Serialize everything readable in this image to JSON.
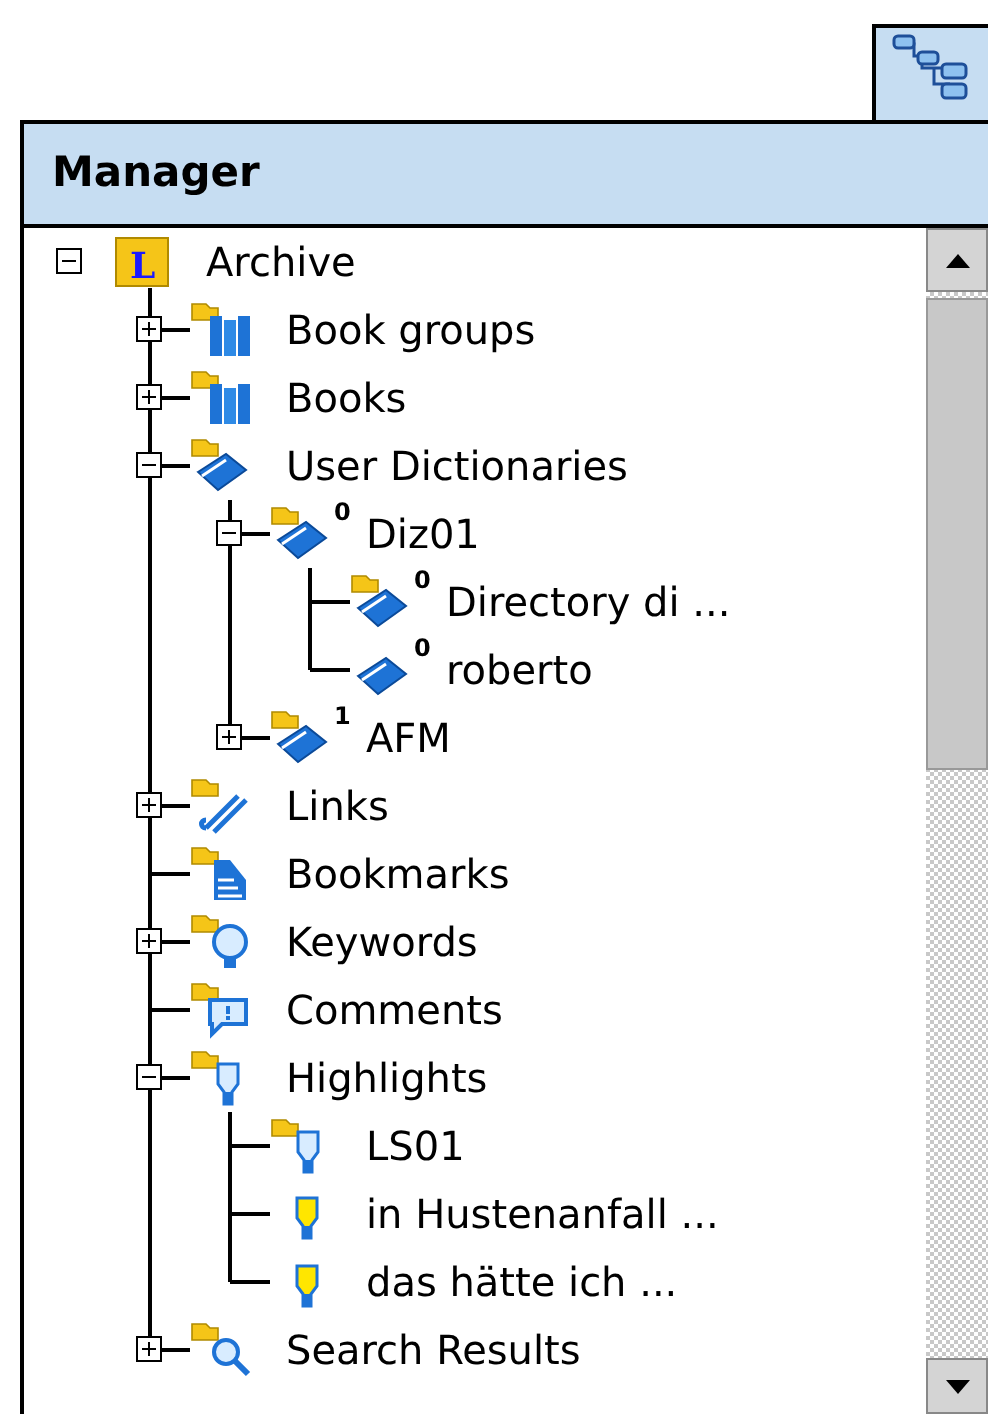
{
  "panel": {
    "title": "Manager"
  },
  "tree": [
    {
      "label": "Archive",
      "kind": "archive",
      "icon_letter": "L",
      "expanded": true,
      "children": [
        {
          "label": "Book groups",
          "kind": "book-group",
          "expanded": false
        },
        {
          "label": "Books",
          "kind": "books",
          "expanded": false
        },
        {
          "label": "User Dictionaries",
          "kind": "dictionary",
          "expanded": true,
          "children": [
            {
              "label": "Diz01",
              "kind": "dictionary",
              "badge": "0",
              "expanded": true,
              "children": [
                {
                  "label": "Directory di ...",
                  "kind": "dictionary",
                  "badge": "0"
                },
                {
                  "label": "roberto",
                  "kind": "dictionary-item",
                  "badge": "0"
                }
              ]
            },
            {
              "label": "AFM",
              "kind": "dictionary",
              "badge": "1",
              "expanded": false
            }
          ]
        },
        {
          "label": "Links",
          "kind": "link",
          "expanded": false
        },
        {
          "label": "Bookmarks",
          "kind": "bookmark"
        },
        {
          "label": "Keywords",
          "kind": "keyword",
          "expanded": false
        },
        {
          "label": "Comments",
          "kind": "comment"
        },
        {
          "label": "Highlights",
          "kind": "highlight",
          "expanded": true,
          "children": [
            {
              "label": "LS01",
              "kind": "highlight"
            },
            {
              "label": "in Hustenanfall ...",
              "kind": "highlight-item"
            },
            {
              "label": "das hätte ich ...",
              "kind": "highlight-item"
            }
          ]
        },
        {
          "label": "Search Results",
          "kind": "search",
          "expanded": false
        }
      ]
    }
  ]
}
